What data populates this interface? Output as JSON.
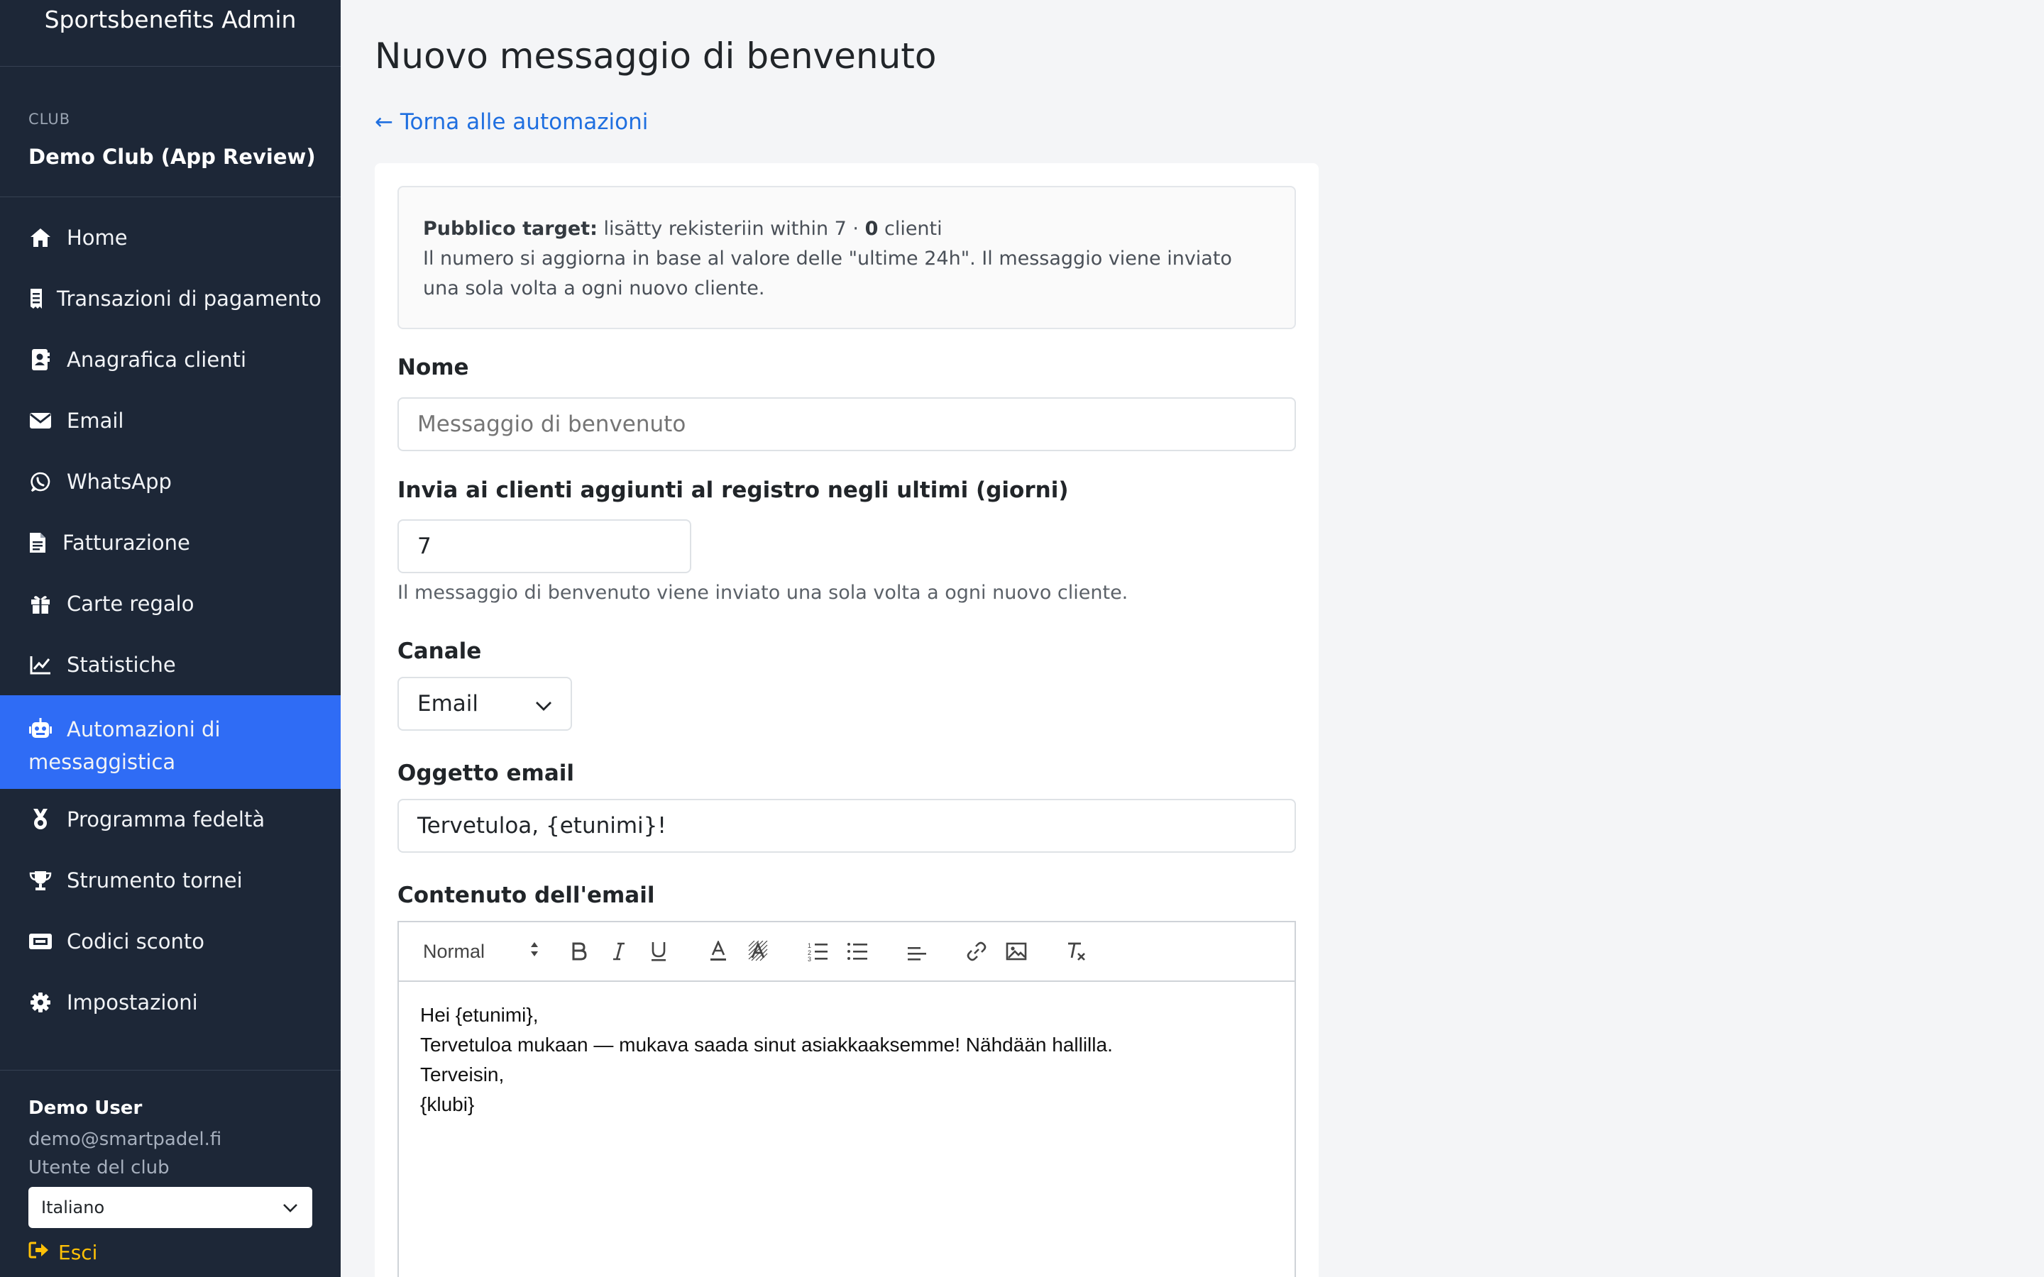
{
  "sidebar": {
    "brand": "Sportsbenefits Admin",
    "club_label": "CLUB",
    "club_name": "Demo Club (App Review)",
    "items": [
      {
        "label": "Home",
        "icon": "home-icon"
      },
      {
        "label": "Transazioni di pagamento",
        "icon": "receipt-icon"
      },
      {
        "label": "Anagrafica clienti",
        "icon": "contact-book-icon"
      },
      {
        "label": "Email",
        "icon": "envelope-icon"
      },
      {
        "label": "WhatsApp",
        "icon": "whatsapp-icon"
      },
      {
        "label": "Fatturazione",
        "icon": "invoice-icon"
      },
      {
        "label": "Carte regalo",
        "icon": "gift-icon"
      },
      {
        "label": "Statistiche",
        "icon": "chart-line-icon"
      },
      {
        "label": "Automazioni di messaggistica",
        "icon": "robot-icon",
        "active": true
      },
      {
        "label": "Programma fedeltà",
        "icon": "medal-icon"
      },
      {
        "label": "Strumento tornei",
        "icon": "trophy-icon"
      },
      {
        "label": "Codici sconto",
        "icon": "ticket-icon"
      },
      {
        "label": "Impostazioni",
        "icon": "gear-icon"
      }
    ],
    "user": {
      "name": "Demo User",
      "email": "demo@smartpadel.fi",
      "role": "Utente del club",
      "language": "Italiano",
      "logout": "Esci"
    },
    "active_color": "#2f6cf5",
    "background_color": "#1d2737"
  },
  "main": {
    "title": "Nuovo messaggio di benvenuto",
    "back_link": "← Torna alle automazioni",
    "info": {
      "label": "Pubblico target:",
      "text": "lisätty rekisteriin within 7 · ",
      "count": "0",
      "count_suffix": " clienti",
      "description": "Il numero si aggiorna in base al valore delle \"ultime 24h\". Il messaggio viene inviato una sola volta a ogni nuovo cliente."
    },
    "name_field": {
      "label": "Nome",
      "placeholder": "Messaggio di benvenuto",
      "value": ""
    },
    "days_field": {
      "label": "Invia ai clienti aggiunti al registro negli ultimi (giorni)",
      "value": "7",
      "help": "Il messaggio di benvenuto viene inviato una sola volta a ogni nuovo cliente."
    },
    "channel_field": {
      "label": "Canale",
      "value": "Email"
    },
    "subject_field": {
      "label": "Oggetto email",
      "value": "Tervetuloa, {etunimi}!"
    },
    "content_field": {
      "label": "Contenuto dell'email",
      "format": "Normal",
      "toolbar_icons": [
        "bold-icon",
        "italic-icon",
        "underline-icon",
        "text-color-icon",
        "background-color-icon",
        "ordered-list-icon",
        "bullet-list-icon",
        "align-icon",
        "link-icon",
        "image-icon",
        "clear-format-icon"
      ],
      "lines": [
        "Hei {etunimi},",
        "Tervetuloa mukaan — mukava saada sinut asiakkaaksemme! Nähdään hallilla.",
        "Terveisin,",
        "{klubi}"
      ]
    },
    "link_color": "#1f6fe0"
  }
}
